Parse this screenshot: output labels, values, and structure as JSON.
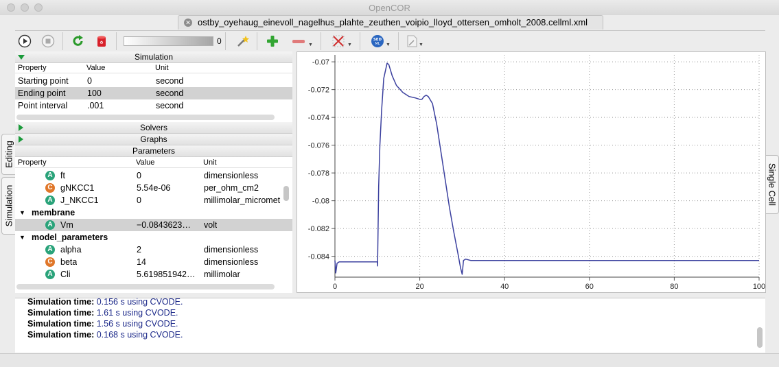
{
  "window": {
    "title": "OpenCOR"
  },
  "file_tab": {
    "name": "ostby_oyehaug_einevoll_nagelhus_plahte_zeuthen_voipio_lloyd_ottersen_omholt_2008.cellml.xml"
  },
  "toolbar": {
    "progress_value": "0",
    "progress_fraction": 0,
    "icons": [
      "run-icon",
      "stop-icon",
      "reload-icon",
      "clear-icon",
      "wand-icon",
      "add-icon",
      "remove-icon",
      "cross-grid-icon",
      "sedml-icon",
      "export-icon"
    ],
    "sedml_label": "SED ML"
  },
  "side_tabs": {
    "editing": "Editing",
    "simulation": "Simulation",
    "single_cell": "Single Cell"
  },
  "simulation": {
    "header": "Simulation",
    "columns": [
      "Property",
      "Value",
      "Unit"
    ],
    "rows": [
      {
        "property": "Starting point",
        "value": "0",
        "unit": "second"
      },
      {
        "property": "Ending point",
        "value": "100",
        "unit": "second"
      },
      {
        "property": "Point interval",
        "value": ".001",
        "unit": "second"
      }
    ]
  },
  "solvers": {
    "header": "Solvers"
  },
  "graphs": {
    "header": "Graphs"
  },
  "parameters": {
    "header": "Parameters",
    "columns": [
      "Property",
      "Value",
      "Unit"
    ],
    "rows": [
      {
        "badge": "A",
        "name": "ft",
        "value": "0",
        "unit": "dimensionless"
      },
      {
        "badge": "C",
        "name": "gNKCC1",
        "value": "5.54e-06",
        "unit": "per_ohm_cm2"
      },
      {
        "badge": "A",
        "name": "J_NKCC1",
        "value": "0",
        "unit": "millimolar_micrometre"
      },
      {
        "group": "membrane"
      },
      {
        "badge": "A",
        "name": "Vm",
        "value": "−0.0843623…",
        "unit": "volt"
      },
      {
        "group": "model_parameters"
      },
      {
        "badge": "A",
        "name": "alpha",
        "value": "2",
        "unit": "dimensionless"
      },
      {
        "badge": "C",
        "name": "beta",
        "value": "14",
        "unit": "dimensionless"
      },
      {
        "badge": "A",
        "name": "Cli",
        "value": "5.619851942…",
        "unit": "millimolar"
      }
    ]
  },
  "console": {
    "label": "Simulation time:",
    "lines": [
      {
        "time": "0.156 s using CVODE.",
        "color": "#1d2a8a"
      },
      {
        "time": "1.61 s using CVODE.",
        "color": "#1d2a8a"
      },
      {
        "time": "1.56 s using CVODE.",
        "color": "#1d2a8a"
      },
      {
        "time": "0.168 s using CVODE.",
        "color": "#1d2a8a"
      }
    ]
  },
  "chart_data": {
    "type": "line",
    "xlim": [
      0,
      100
    ],
    "ylim": [
      -0.0855,
      -0.0695
    ],
    "x_ticks": [
      "0",
      "20",
      "40",
      "60",
      "80",
      "100"
    ],
    "y_ticks": [
      "-0.07",
      "-0.072",
      "-0.074",
      "-0.076",
      "-0.078",
      "-0.08",
      "-0.082",
      "-0.084"
    ],
    "grid": true,
    "line_color": "#3a3f9e",
    "series": [
      {
        "x": [
          0,
          0.2,
          0.5,
          1,
          5,
          10,
          10.05,
          10.3,
          10.6,
          11,
          11.5,
          12,
          12.3,
          12.7,
          13.5,
          14.5,
          16,
          17.5,
          19,
          20,
          20.5,
          21,
          21.5,
          22,
          23,
          24,
          25,
          26,
          27,
          28,
          29,
          29.6,
          30,
          30.3,
          30.8,
          32,
          35,
          50,
          70,
          90,
          100
        ],
        "y": [
          -0.0843,
          -0.0852,
          -0.0845,
          -0.0844,
          -0.0844,
          -0.0844,
          -0.0847,
          -0.079,
          -0.076,
          -0.0735,
          -0.0712,
          -0.0705,
          -0.0701,
          -0.0702,
          -0.071,
          -0.0717,
          -0.0722,
          -0.0725,
          -0.0726,
          -0.0727,
          -0.0727,
          -0.0725,
          -0.0724,
          -0.0725,
          -0.073,
          -0.0745,
          -0.0765,
          -0.0785,
          -0.0805,
          -0.0822,
          -0.0838,
          -0.0848,
          -0.0853,
          -0.0843,
          -0.0842,
          -0.0843,
          -0.0843,
          -0.0843,
          -0.0843,
          -0.0843,
          -0.0843
        ]
      }
    ]
  }
}
